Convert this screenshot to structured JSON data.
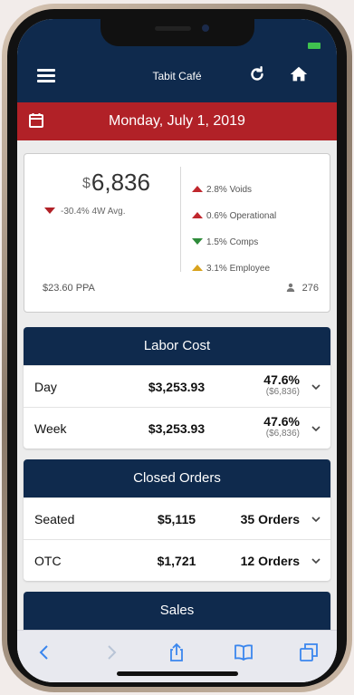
{
  "header": {
    "title": "Tabit Café"
  },
  "date_bar": {
    "date": "Monday, July 1, 2019"
  },
  "summary": {
    "currency_symbol": "$",
    "total": "6,836",
    "avg_change": "-30.4% 4W Avg.",
    "metrics": [
      {
        "value": "2.8% Voids",
        "trend": "up",
        "color": "#c0272d"
      },
      {
        "value": "0.6% Operational",
        "trend": "up",
        "color": "#c0272d"
      },
      {
        "value": "1.5% Comps",
        "trend": "down",
        "color": "#2e8b3a"
      },
      {
        "value": "3.1% Employee",
        "trend": "up",
        "color": "#d9a31e"
      }
    ],
    "ppa": "$23.60 PPA",
    "guests": "276"
  },
  "labor_cost": {
    "title": "Labor Cost",
    "rows": [
      {
        "label": "Day",
        "amount": "$3,253.93",
        "percent": "47.6%",
        "of_total": "($6,836)"
      },
      {
        "label": "Week",
        "amount": "$3,253.93",
        "percent": "47.6%",
        "of_total": "($6,836)"
      }
    ]
  },
  "closed_orders": {
    "title": "Closed Orders",
    "rows": [
      {
        "label": "Seated",
        "amount": "$5,115",
        "orders": "35 Orders"
      },
      {
        "label": "OTC",
        "amount": "$1,721",
        "orders": "12 Orders"
      }
    ]
  },
  "sales": {
    "title": "Sales"
  },
  "colors": {
    "navy": "#0f2a4d",
    "red_bar": "#b12127",
    "ios_blue": "#3a86ee"
  }
}
